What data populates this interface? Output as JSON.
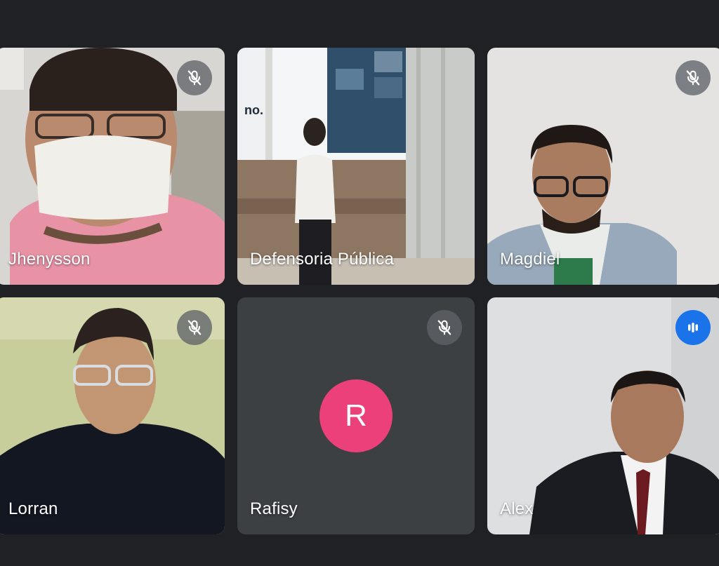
{
  "participants": [
    {
      "name": "Jhenysson",
      "mic": "muted",
      "mic_icon": "mic-off-icon"
    },
    {
      "name": "Defensoria Pública",
      "mic": "none"
    },
    {
      "name": "Magdiel",
      "mic": "muted",
      "mic_icon": "mic-off-icon"
    },
    {
      "name": "Lorran",
      "mic": "muted",
      "mic_icon": "mic-off-icon"
    },
    {
      "name": "Rafisy",
      "mic": "muted",
      "mic_icon": "mic-off-icon",
      "avatar_letter": "R",
      "avatar_color": "#ec407a"
    },
    {
      "name": "Alex",
      "mic": "speaking",
      "mic_icon": "speaking-indicator-icon"
    }
  ],
  "colors": {
    "background": "#202124",
    "speaking_accent": "#1a73e8",
    "avatar": "#ec407a"
  }
}
